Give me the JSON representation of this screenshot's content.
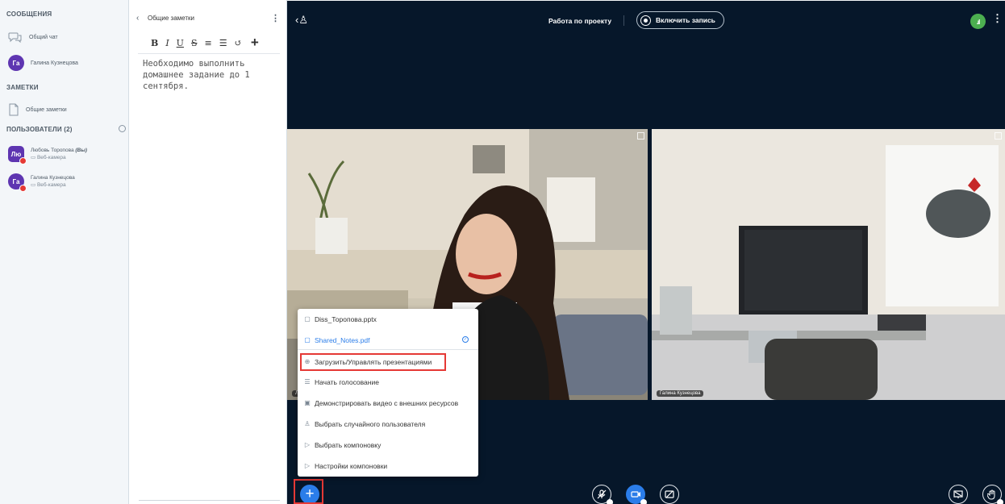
{
  "sidebar": {
    "messages_heading": "СООБЩЕНИЯ",
    "public_chat": {
      "label": "Общий чат",
      "icon": "chat-bubbles-icon"
    },
    "private_chat": {
      "initials": "Га",
      "name": "Галина Кузнецова"
    },
    "notes_heading": "ЗАМЕТКИ",
    "shared_notes": {
      "label": "Общие заметки",
      "icon": "document-icon"
    },
    "users_heading": "ПОЛЬЗОВАТЕЛИ (2)",
    "users": [
      {
        "initials": "Лю",
        "name": "Любовь Торопова",
        "you": "(Вы)",
        "status": "Веб-камера"
      },
      {
        "initials": "Га",
        "name": "Галина Кузнецова",
        "you": "",
        "status": "Веб-камера"
      }
    ]
  },
  "notes": {
    "title": "Общие заметки",
    "toolbar": [
      "B",
      "I",
      "U",
      "S",
      "≡",
      "☰",
      "↺",
      "+"
    ],
    "text": "Необходимо выполнить домашнее задание до 1 сентября."
  },
  "main": {
    "meeting_title": "Работа по проекту",
    "record_label": "Включить запись",
    "connection_label": ".ıl",
    "videos": [
      {
        "name": "Л"
      },
      {
        "name": "Галина Кузнецова"
      }
    ]
  },
  "menu": {
    "items": [
      {
        "label": "Diss_Торопова.pptx",
        "icon": "file-icon"
      },
      {
        "label": "Shared_Notes.pdf",
        "icon": "file-icon",
        "selected": true
      },
      {
        "label": "Загрузить/Управлять презентациями",
        "icon": "upload-icon"
      },
      {
        "label": "Начать голосование",
        "icon": "poll-icon"
      },
      {
        "label": "Демонстрировать видео с внешних ресурсов",
        "icon": "external-video-icon"
      },
      {
        "label": "Выбрать случайного пользователя",
        "icon": "user-icon"
      },
      {
        "label": "Выбрать компоновку",
        "icon": "layout-icon"
      },
      {
        "label": "Настройки компоновки",
        "icon": "layout-settings-icon"
      }
    ]
  },
  "colors": {
    "main_bg": "#06172a",
    "accent": "#2b7de9",
    "highlight_frame": "#e53935",
    "connection_ok": "#4caf50"
  }
}
